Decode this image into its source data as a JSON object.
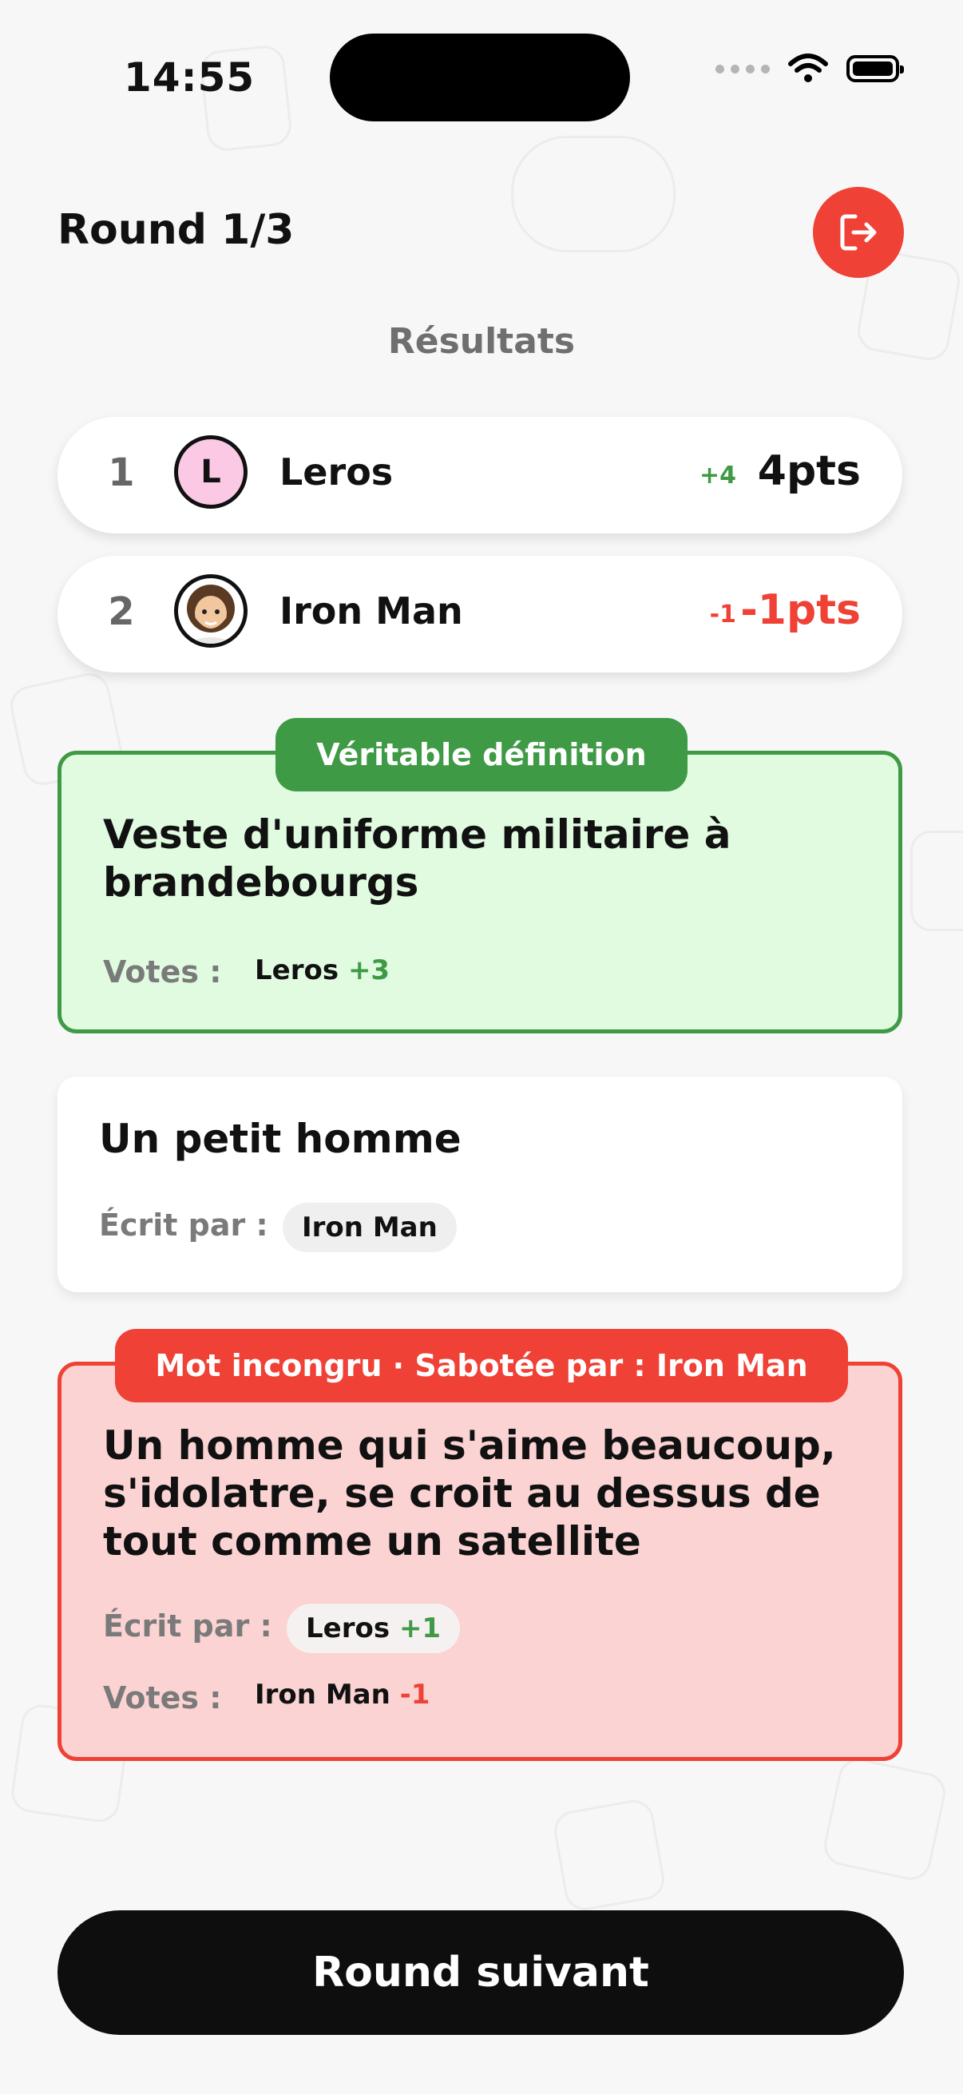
{
  "status_bar": {
    "time": "14:55"
  },
  "header": {
    "round_label": "Round 1/3"
  },
  "section_title": "Résultats",
  "scores": [
    {
      "rank": "1",
      "avatar_letter": "L",
      "name": "Leros",
      "delta": "+4",
      "points": "4pts"
    },
    {
      "rank": "2",
      "name": "Iron Man",
      "delta": "-1",
      "points": "-1pts"
    }
  ],
  "cards": {
    "true_definition": {
      "tag": "Véritable définition",
      "text": "Veste d'uniforme militaire à brandebourgs",
      "votes_label": "Votes :",
      "vote_name": "Leros",
      "vote_delta": "+3"
    },
    "plain_definition": {
      "text": "Un petit homme",
      "written_by_label": "Écrit par :",
      "author": "Iron Man"
    },
    "sabotaged_definition": {
      "tag": "Mot incongru · Sabotée par : Iron Man",
      "text": "Un homme qui s'aime beaucoup, s'idolatre, se croit au dessus de tout comme un satellite",
      "written_by_label": "Écrit par :",
      "author": "Leros",
      "author_delta": "+1",
      "votes_label": "Votes :",
      "vote_name": "Iron Man",
      "vote_delta": "-1"
    }
  },
  "footer": {
    "next_button": "Round suivant"
  },
  "colors": {
    "accent_red": "#ef4136",
    "accent_green": "#3f9a45",
    "true_bg": "#e0fbe0",
    "sabotage_bg": "#fbd3d3"
  },
  "icons": {
    "exit": "exit-door-arrow-icon",
    "wifi": "wifi-icon",
    "battery": "battery-icon"
  }
}
